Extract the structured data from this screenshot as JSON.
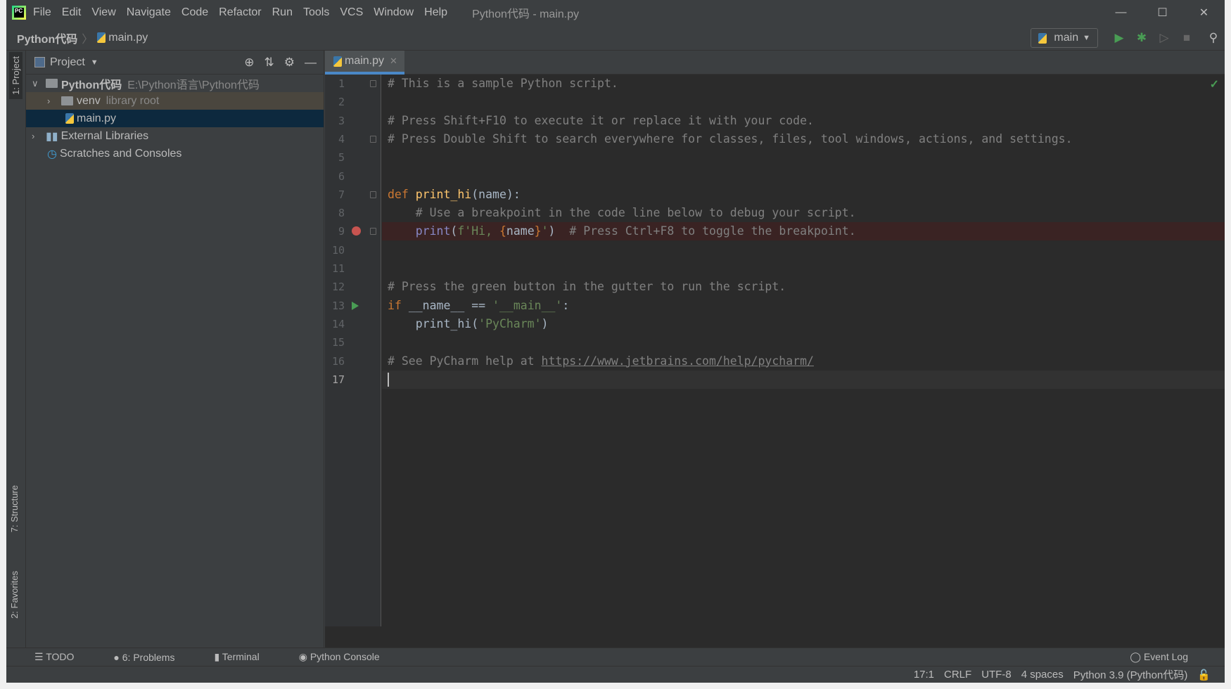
{
  "window": {
    "title": "Python代码 - main.py",
    "logo": "PC"
  },
  "menu": [
    "File",
    "Edit",
    "View",
    "Navigate",
    "Code",
    "Refactor",
    "Run",
    "Tools",
    "VCS",
    "Window",
    "Help"
  ],
  "breadcrumb": {
    "project": "Python代码",
    "file": "main.py"
  },
  "run_config": {
    "label": "main"
  },
  "left_strip": {
    "project": "1: Project",
    "structure": "7: Structure",
    "favorites": "2: Favorites"
  },
  "project_panel": {
    "title": "Project",
    "tree": [
      {
        "label": "Python代码",
        "note": "E:\\Python语言\\Python代码"
      },
      {
        "label": "venv",
        "note": "library root"
      },
      {
        "label": "main.py"
      },
      {
        "label": "External Libraries"
      },
      {
        "label": "Scratches and Consoles"
      }
    ]
  },
  "editor": {
    "tab": "main.py",
    "lines": [
      [
        [
          "comment",
          "# This is a sample Python script."
        ]
      ],
      [],
      [
        [
          "comment",
          "# Press Shift+F10 to execute it or replace it with your code."
        ]
      ],
      [
        [
          "comment",
          "# Press Double Shift to search everywhere for classes, files, tool windows, actions, and settings."
        ]
      ],
      [],
      [],
      [
        [
          "kw",
          "def "
        ],
        [
          "fn",
          "print_hi"
        ],
        [
          "plain",
          "(name):"
        ]
      ],
      [
        [
          "comment",
          "    # Use a breakpoint in the code line below to debug your script."
        ]
      ],
      [
        [
          "plain",
          "    "
        ],
        [
          "builtin",
          "print"
        ],
        [
          "plain",
          "("
        ],
        [
          "str",
          "f'Hi, "
        ],
        [
          "kw",
          "{"
        ],
        [
          "plain",
          "name"
        ],
        [
          "kw",
          "}"
        ],
        [
          "str",
          "'"
        ],
        [
          "plain",
          ")  "
        ],
        [
          "comment",
          "# Press Ctrl+F8 to toggle the breakpoint."
        ]
      ],
      [],
      [],
      [
        [
          "comment",
          "# Press the green button in the gutter to run the script."
        ]
      ],
      [
        [
          "kw",
          "if "
        ],
        [
          "plain",
          "__name__ == "
        ],
        [
          "str",
          "'__main__'"
        ],
        [
          "plain",
          ":"
        ]
      ],
      [
        [
          "plain",
          "    print_hi("
        ],
        [
          "str",
          "'PyCharm'"
        ],
        [
          "plain",
          ")"
        ]
      ],
      [],
      [
        [
          "comment",
          "# See PyCharm help at "
        ],
        [
          "link",
          "https://www.jetbrains.com/help/pycharm/"
        ]
      ],
      []
    ],
    "breakpoint_line": 9,
    "run_line": 13,
    "caret_line": 17
  },
  "bottom_tools": [
    "TODO",
    "6: Problems",
    "Terminal",
    "Python Console"
  ],
  "event_log": "Event Log",
  "status": {
    "position": "17:1",
    "line_sep": "CRLF",
    "encoding": "UTF-8",
    "indent": "4 spaces",
    "interpreter": "Python 3.9 (Python代码)"
  },
  "colors": {
    "accent": "#4a88c7",
    "breakpoint": "#c75450",
    "run": "#499c54",
    "selection": "#0d293e"
  }
}
